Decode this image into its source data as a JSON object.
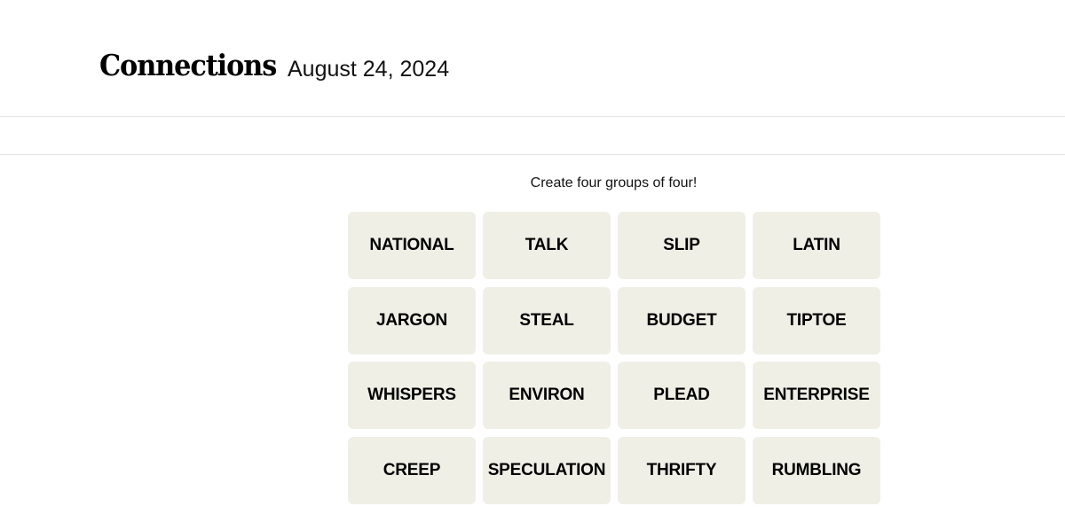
{
  "header": {
    "title": "Connections",
    "date": "August 24, 2024"
  },
  "game": {
    "instructions": "Create four groups of four!",
    "tiles": [
      "NATIONAL",
      "TALK",
      "SLIP",
      "LATIN",
      "JARGON",
      "STEAL",
      "BUDGET",
      "TIPTOE",
      "WHISPERS",
      "ENVIRON",
      "PLEAD",
      "ENTERPRISE",
      "CREEP",
      "SPECULATION",
      "THRIFTY",
      "RUMBLING"
    ]
  },
  "colors": {
    "tile_background": "#efefe6",
    "text": "#000000"
  }
}
